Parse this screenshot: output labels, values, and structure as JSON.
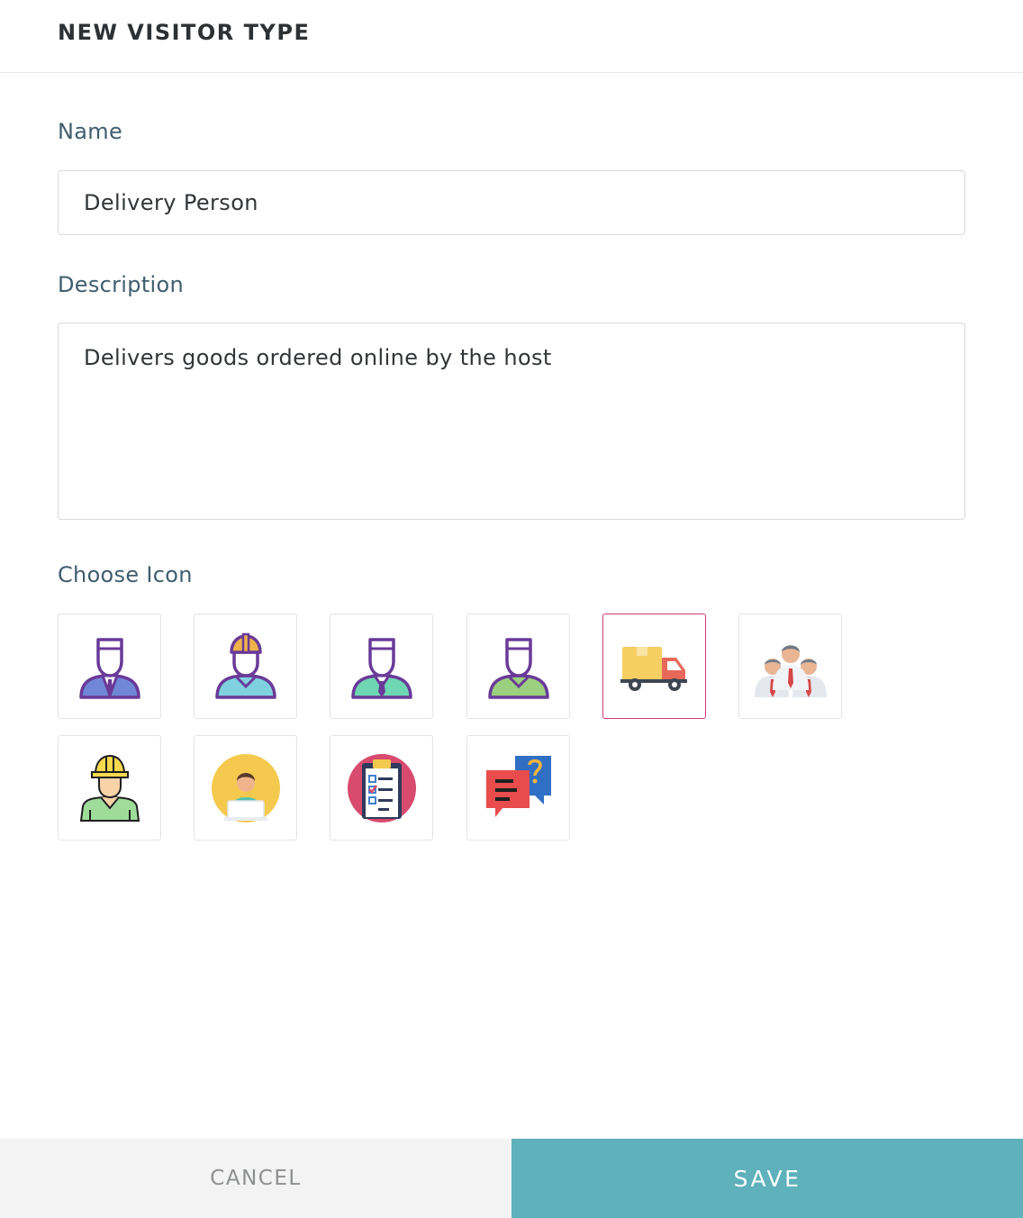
{
  "header": {
    "title": "NEW VISITOR TYPE"
  },
  "form": {
    "name_label": "Name",
    "name_value": "Delivery Person",
    "description_label": "Description",
    "description_value": "Delivers goods ordered online by the host",
    "icon_label": "Choose Icon"
  },
  "icons": [
    {
      "name": "business-person-icon",
      "selected": false
    },
    {
      "name": "engineer-helmet-icon",
      "selected": false
    },
    {
      "name": "person-tie-icon",
      "selected": false
    },
    {
      "name": "person-green-icon",
      "selected": false
    },
    {
      "name": "delivery-truck-icon",
      "selected": true
    },
    {
      "name": "team-group-icon",
      "selected": false
    },
    {
      "name": "construction-worker-icon",
      "selected": false
    },
    {
      "name": "laptop-user-icon",
      "selected": false
    },
    {
      "name": "clipboard-checklist-icon",
      "selected": false
    },
    {
      "name": "chat-question-icon",
      "selected": false
    }
  ],
  "colors": {
    "accent": "#5fb1bb",
    "selected_border": "#cc3a78",
    "label": "#3f5e6e"
  },
  "footer": {
    "cancel_label": "CANCEL",
    "save_label": "SAVE"
  }
}
